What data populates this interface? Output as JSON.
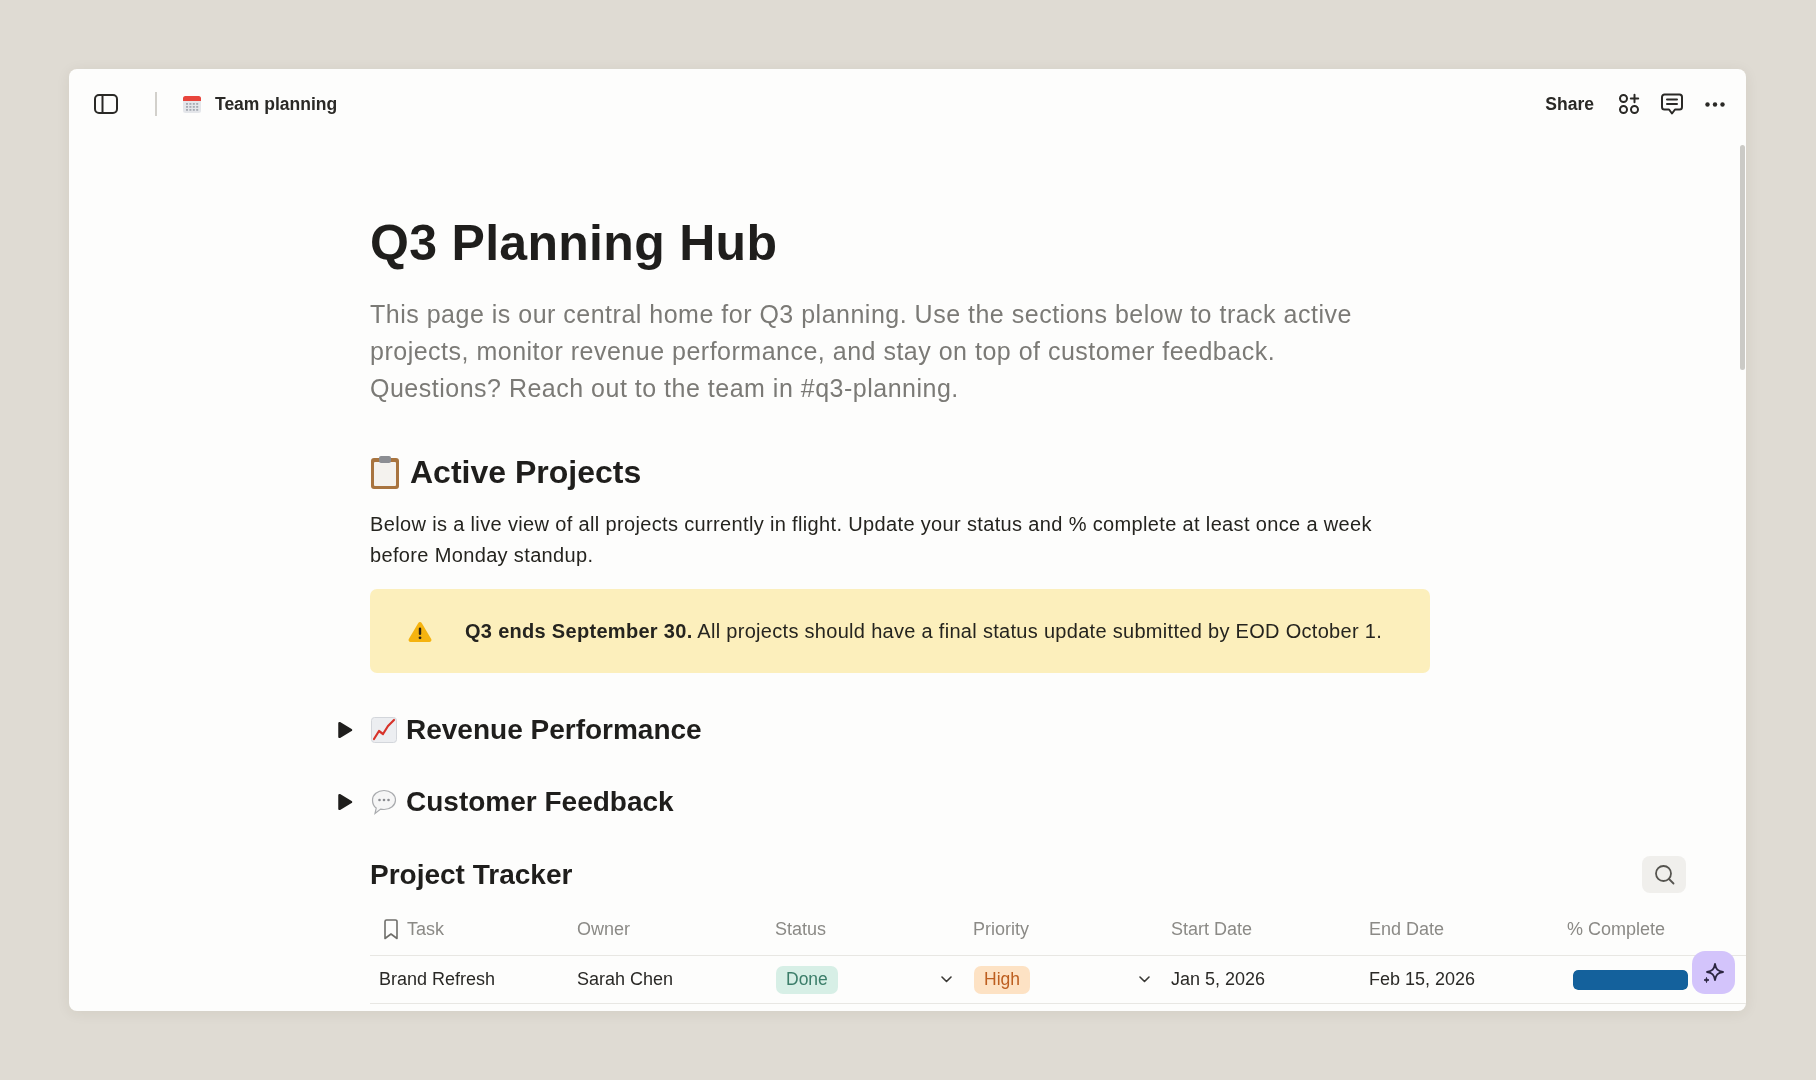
{
  "top_bar": {
    "page_title": "Team planning",
    "share_label": "Share"
  },
  "page": {
    "title": "Q3 Planning Hub",
    "intro": "This page is our central home for Q3 planning. Use the sections below to track active projects, monitor revenue performance, and stay on top of customer feedback. Questions? Reach out to the team in #q3-planning."
  },
  "active_projects": {
    "heading": "Active Projects",
    "description": "Below is a live view of all projects currently in flight. Update your status and % complete at least once a week before Monday standup.",
    "callout": "**Q3 ends September 30.** All projects should have a final status update submitted by EOD October 1."
  },
  "revenue_performance": {
    "heading": "Revenue Performance",
    "expanded": false
  },
  "customer_feedback": {
    "heading": "Customer Feedback",
    "expanded": false
  },
  "project_tracker": {
    "title": "Project Tracker",
    "columns": [
      "Task",
      "Owner",
      "Status",
      "Priority",
      "Start Date",
      "End Date",
      "% Complete"
    ],
    "rows": [
      {
        "task": "Brand Refresh",
        "owner": "Sarah Chen",
        "status": {
          "label": "Done",
          "color": "#d7efe6"
        },
        "priority": {
          "label": "High",
          "color": "#fde2c4"
        },
        "start_date": "Jan 5, 2026",
        "end_date": "Feb 15, 2026",
        "level": 1
      }
    ]
  }
}
